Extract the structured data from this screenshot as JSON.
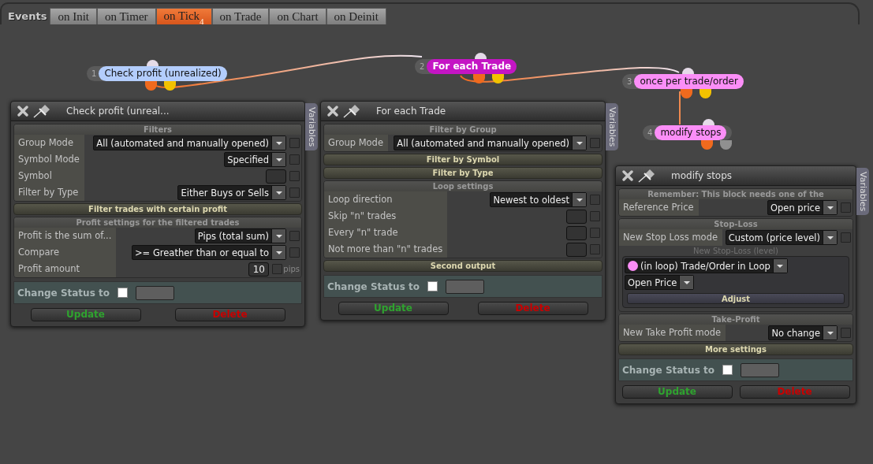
{
  "events_label": "Events",
  "tabs": [
    {
      "label": "on Init",
      "selected": false
    },
    {
      "label": "on Timer",
      "selected": false
    },
    {
      "label": "on Tick",
      "selected": true,
      "badge": "4"
    },
    {
      "label": "on Trade",
      "selected": false
    },
    {
      "label": "on Chart",
      "selected": false
    },
    {
      "label": "on Deinit",
      "selected": false
    }
  ],
  "nodes": [
    {
      "number": "1",
      "label": "Check profit (unrealized)",
      "color": "#b3cdfc",
      "outputs": [
        {
          "color": "#f06a1e"
        },
        {
          "color": "#f2c200"
        }
      ]
    },
    {
      "number": "2",
      "label": "For each Trade",
      "color": "#c415c4",
      "outputs": [
        {
          "color": "#f06a1e"
        },
        {
          "color": "#f2c200"
        }
      ]
    },
    {
      "number": "3",
      "label": "once per trade/order",
      "color": "#fb8ef7",
      "outputs": [
        {
          "color": "#f06a1e"
        },
        {
          "color": "#f2c200"
        }
      ]
    },
    {
      "number": "4",
      "label": "modify stops",
      "color": "#fb8ef7",
      "outputs": [
        {
          "color": "#f06a1e"
        },
        {
          "color": "#909090"
        }
      ]
    }
  ],
  "panels": [
    {
      "title": "Check profit (unreal...",
      "side_tab": "Variables",
      "sections": [
        {
          "kind": "group",
          "title": "Filters",
          "rows": [
            {
              "kind": "select",
              "label": "Group Mode",
              "value": "All (automated and manually opened)",
              "checked": false
            },
            {
              "kind": "select",
              "label": "Symbol Mode",
              "value": "Specified",
              "checked": false
            },
            {
              "kind": "input",
              "label": "Symbol",
              "value": "",
              "checked": false
            },
            {
              "kind": "select",
              "label": "Filter by Type",
              "value": "Either Buys or Sells",
              "checked": false
            }
          ]
        },
        {
          "kind": "header",
          "title": "Filter trades with certain profit"
        },
        {
          "kind": "group",
          "title": "Profit settings for the filtered trades",
          "rows": [
            {
              "kind": "select",
              "label": "Profit is the sum of...",
              "value": "Pips (total sum)",
              "checked": false
            },
            {
              "kind": "select",
              "label": "Compare",
              "value": ">= Greather than or equal to",
              "checked": false
            },
            {
              "kind": "input",
              "label": "Profit amount",
              "value": "10",
              "unit": "pips",
              "checked": false
            }
          ]
        },
        {
          "kind": "status",
          "label": "Change Status to",
          "checked": false
        }
      ],
      "buttons": [
        "Update",
        "Delete"
      ]
    },
    {
      "title": "For each Trade",
      "side_tab": "Variables",
      "sections": [
        {
          "kind": "group",
          "title": "Filter by Group",
          "rows": [
            {
              "kind": "select",
              "label": "Group Mode",
              "value": "All (automated and manually opened)",
              "checked": false
            }
          ]
        },
        {
          "kind": "header",
          "title": "Filter by Symbol"
        },
        {
          "kind": "header",
          "title": "Filter by Type"
        },
        {
          "kind": "group",
          "title": "Loop settings",
          "rows": [
            {
              "kind": "select",
              "label": "Loop direction",
              "value": "Newest to oldest",
              "checked": false
            },
            {
              "kind": "input",
              "label": "Skip \"n\" trades",
              "value": "",
              "checked": false
            },
            {
              "kind": "input",
              "label": "Every \"n\" trade",
              "value": "",
              "checked": false
            },
            {
              "kind": "input",
              "label": "Not more than \"n\" trades",
              "value": "",
              "checked": false
            }
          ]
        },
        {
          "kind": "header",
          "title": "Second output"
        },
        {
          "kind": "status",
          "label": "Change Status to",
          "checked": false
        }
      ],
      "buttons": [
        "Update",
        "Delete"
      ]
    },
    {
      "title": "modify stops",
      "side_tab": "Variables",
      "sections": [
        {
          "kind": "group",
          "title": "Remember: This block needs one of the",
          "rows": [
            {
              "kind": "select",
              "label": "Reference Price",
              "value": "Open price",
              "checked": false
            }
          ]
        },
        {
          "kind": "group",
          "title": "Stop-Loss",
          "rows": [
            {
              "kind": "select",
              "label": "New Stop Loss mode",
              "value": "Custom (price level)",
              "checked": false
            },
            {
              "kind": "level",
              "title": "New Stop-Loss (level)",
              "source": {
                "value": "(in loop) Trade/Order in Loop",
                "color": "#fb8ef7"
              },
              "field": "Open Price",
              "button": "Adjust"
            }
          ]
        },
        {
          "kind": "group",
          "title": "Take-Profit",
          "rows": [
            {
              "kind": "select",
              "label": "New Take Profit mode",
              "value": "No change",
              "checked": false
            }
          ]
        },
        {
          "kind": "header",
          "title": "More settings"
        },
        {
          "kind": "status",
          "label": "Change Status to",
          "checked": false
        }
      ],
      "buttons": [
        "Update",
        "Delete"
      ]
    }
  ]
}
